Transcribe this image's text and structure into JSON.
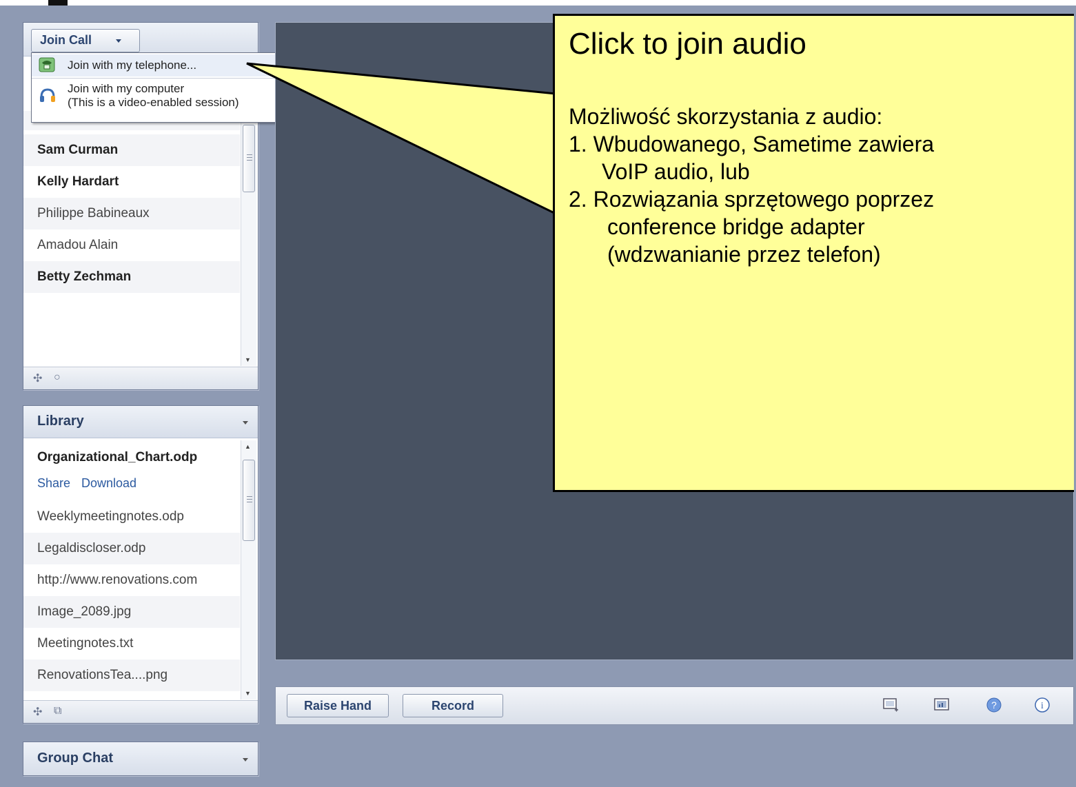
{
  "join_call": {
    "button_label": "Join Call",
    "menu": [
      {
        "icon": "telephone-icon",
        "lines": [
          "Join with my telephone..."
        ]
      },
      {
        "icon": "headset-icon",
        "lines": [
          "Join with my computer",
          "(This is a video-enabled session)"
        ]
      }
    ]
  },
  "participants": {
    "rows": [
      {
        "name": "Sam Curman",
        "bold": true
      },
      {
        "name": "Kelly Hardart",
        "bold": true
      },
      {
        "name": "Philippe Babineaux",
        "bold": false
      },
      {
        "name": "Amadou Alain",
        "bold": false
      },
      {
        "name": "Betty Zechman",
        "bold": true
      }
    ],
    "footer_icons": [
      "add-icon",
      "search-icon"
    ]
  },
  "library": {
    "title": "Library",
    "selected_file": "Organizational_Chart.odp",
    "share_label": "Share",
    "download_label": "Download",
    "files": [
      "Weeklymeetingnotes.odp",
      "Legaldiscloser.odp",
      "http://www.renovations.com",
      "Image_2089.jpg",
      "Meetingnotes.txt",
      "RenovationsTea....png"
    ],
    "footer_icons": [
      "add-icon",
      "copy-icon"
    ]
  },
  "group_chat": {
    "title": "Group Chat"
  },
  "toolbar": {
    "raise_hand_label": "Raise Hand",
    "record_label": "Record",
    "icons": [
      "screen-add-icon",
      "presentation-icon",
      "help-icon",
      "info-icon"
    ]
  },
  "callout": {
    "title": "Click to join audio",
    "intro": "Możliwość skorzystania z audio:",
    "item1_line1": "1. Wbudowanego, Sametime zawiera",
    "item1_line2": "VoIP audio, lub",
    "item2_line1": "2. Rozwiązania sprzętowego poprzez",
    "item2_line2": "conference bridge adapter",
    "item2_line3": "(wdzwanianie przez telefon)"
  },
  "colors": {
    "background": "#8e9ab3",
    "stage": "#485262",
    "callout": "#ffff99",
    "panel_title": "#2a3f63",
    "link": "#2c5aa0"
  }
}
